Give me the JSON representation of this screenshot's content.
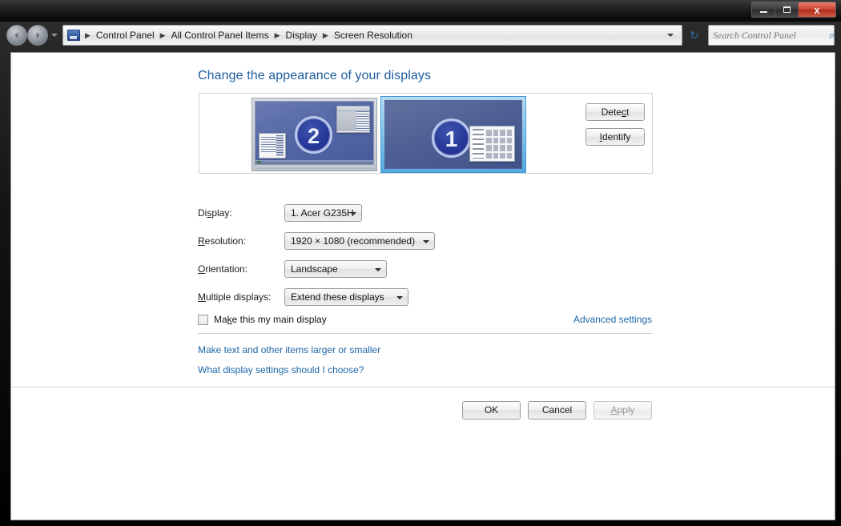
{
  "window": {
    "controls": {
      "minimize": "minimize-button",
      "maximize": "maximize-button",
      "close_label": "x"
    }
  },
  "nav": {
    "back_icon": "back-arrow-icon",
    "forward_icon": "forward-arrow-icon",
    "history_icon": "chevron-down-icon",
    "refresh_icon": "refresh-icon",
    "refresh_glyph": "↻",
    "address_icon": "control-panel-icon",
    "breadcrumbs": [
      {
        "label": "Control Panel"
      },
      {
        "label": "All Control Panel Items"
      },
      {
        "label": "Display"
      },
      {
        "label": "Screen Resolution"
      }
    ],
    "separator": "▶"
  },
  "search": {
    "placeholder": "Search Control Panel",
    "value": "",
    "icon": "search-icon",
    "icon_glyph": "⌕"
  },
  "page": {
    "heading": "Change the appearance of your displays"
  },
  "preview": {
    "monitor_2": {
      "number": "2",
      "label": "display-preview-2"
    },
    "monitor_1": {
      "number": "1",
      "label": "display-preview-1",
      "selected": true
    },
    "detect_label": "Detect",
    "detect_accel_before": "Dete",
    "detect_accel": "c",
    "detect_accel_after": "t",
    "identify_accel": "I",
    "identify_accel_after": "dentify"
  },
  "form": {
    "display": {
      "label_before": "Di",
      "label_accel": "s",
      "label_after": "play:",
      "value": "1. Acer G235H"
    },
    "resolution": {
      "label_accel": "R",
      "label_after": "esolution:",
      "value": "1920 × 1080 (recommended)"
    },
    "orientation": {
      "label_accel": "O",
      "label_after": "rientation:",
      "value": "Landscape"
    },
    "multiple": {
      "label_accel": "M",
      "label_after": "ultiple displays:",
      "value": "Extend these displays"
    }
  },
  "options": {
    "main_display": {
      "label_before": "Ma",
      "label_accel": "k",
      "label_after": "e this my main display",
      "checked": false
    },
    "advanced_link": "Advanced settings"
  },
  "links": {
    "larger": "Make text and other items larger or smaller",
    "choose": "What display settings should I choose?"
  },
  "footer": {
    "ok": "OK",
    "cancel": "Cancel",
    "apply_accel": "A",
    "apply_after": "pply",
    "apply_enabled": false
  },
  "colors": {
    "heading": "#1c5c9e",
    "link": "#1b66a8",
    "selected_monitor_border": "#3f9ad4",
    "titlebar": "#101010",
    "close_button": "#cd4430"
  }
}
